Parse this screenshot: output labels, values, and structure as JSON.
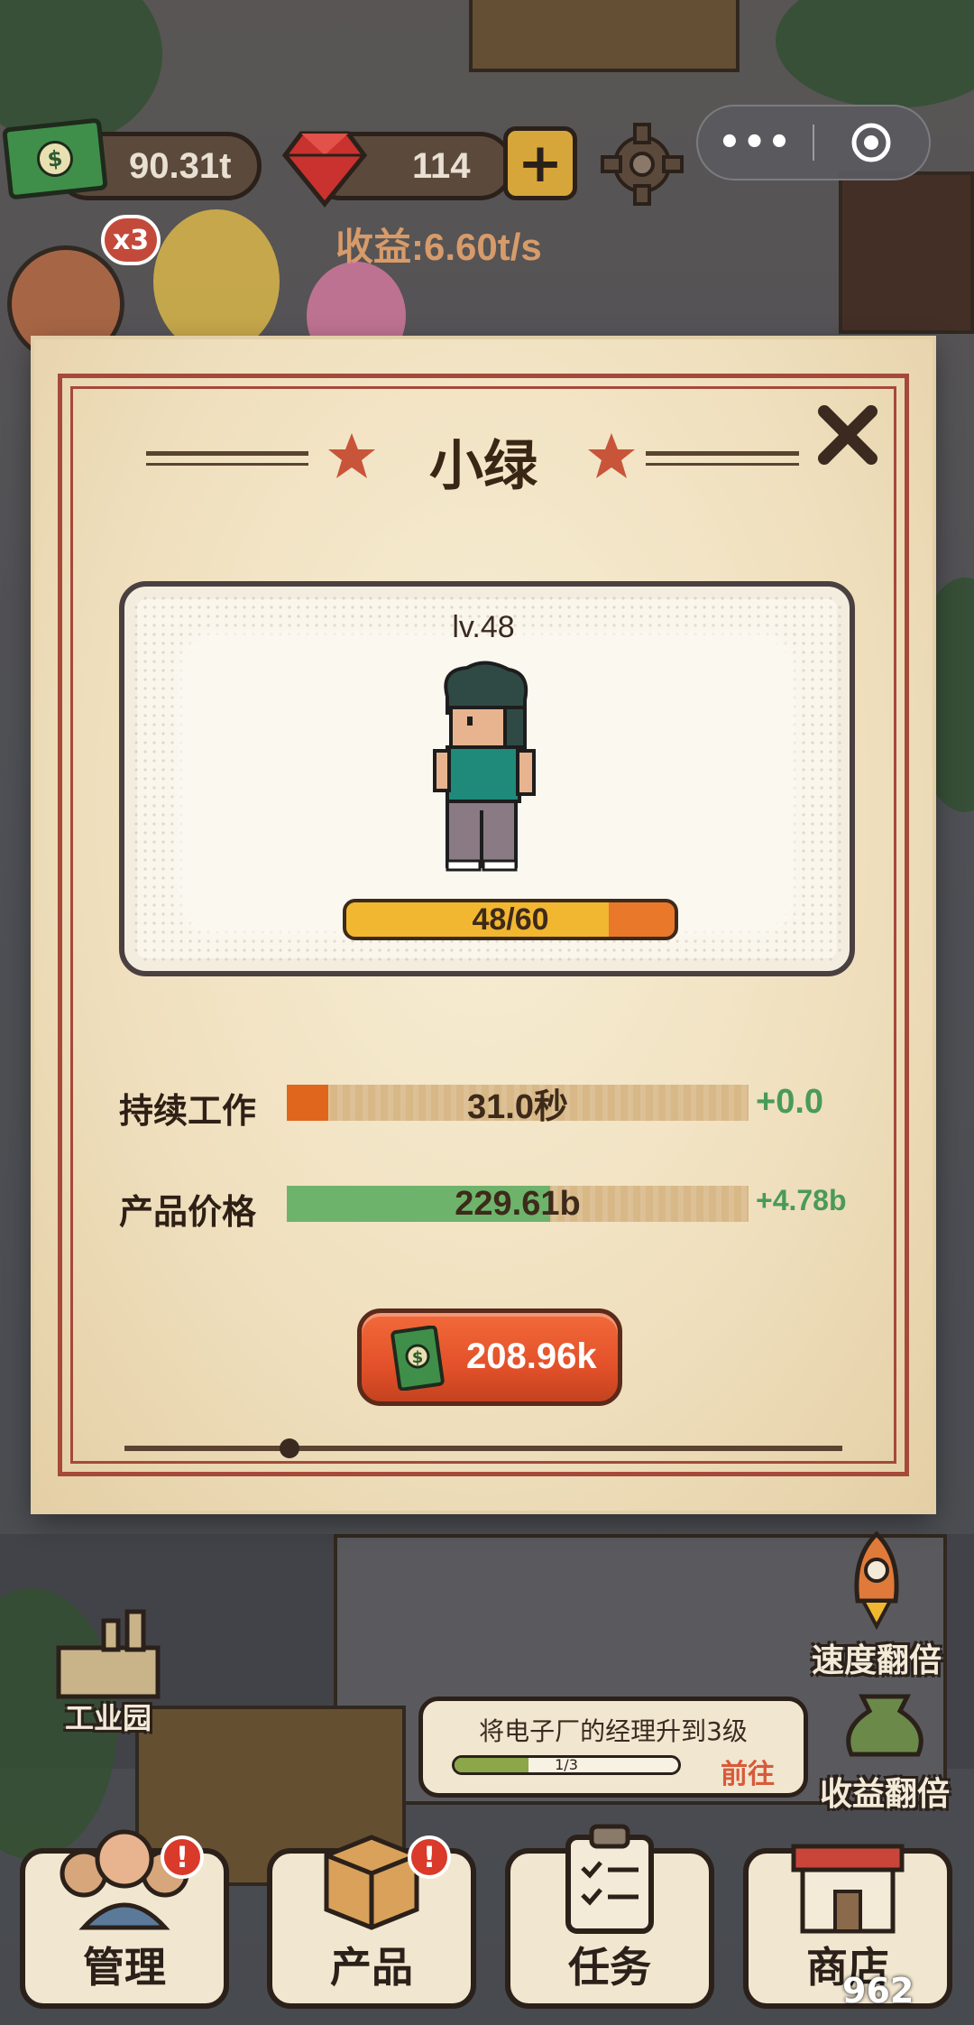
{
  "hud": {
    "cash": "90.31t",
    "gems": "114",
    "income": "收益:6.60t/s",
    "gift_badge": "x3"
  },
  "modal": {
    "title": "小绿",
    "level": "lv.48",
    "xp_text": "48/60",
    "xp_fraction": 0.8,
    "stats": [
      {
        "label": "持续工作",
        "value": "31.0秒",
        "gain": "+0.0",
        "fill_fraction": 0.09,
        "fill_color": "#e0661e"
      },
      {
        "label": "产品价格",
        "value": "229.61b",
        "gain": "+4.78b",
        "fill_fraction": 0.57,
        "fill_color": "#6eb36b"
      }
    ],
    "upgrade_cost": "208.96k",
    "icons": {
      "close": "close-icon",
      "star": "star-icon",
      "money": "money-icon"
    }
  },
  "side": {
    "speed_double": "速度翻倍",
    "income_double": "收益翻倍",
    "industrial_park": "工业园"
  },
  "task": {
    "title": "将电子厂的经理升到3级",
    "progress_text": "1/3",
    "progress_fraction": 0.33,
    "go_label": "前往"
  },
  "nav": [
    {
      "label": "管理",
      "alert": "!"
    },
    {
      "label": "产品",
      "alert": "!"
    },
    {
      "label": "任务"
    },
    {
      "label": "商店"
    }
  ],
  "colors": {
    "accent": "#e3512a",
    "frame": "#a5493a",
    "gain_green": "#4a9a5a"
  }
}
